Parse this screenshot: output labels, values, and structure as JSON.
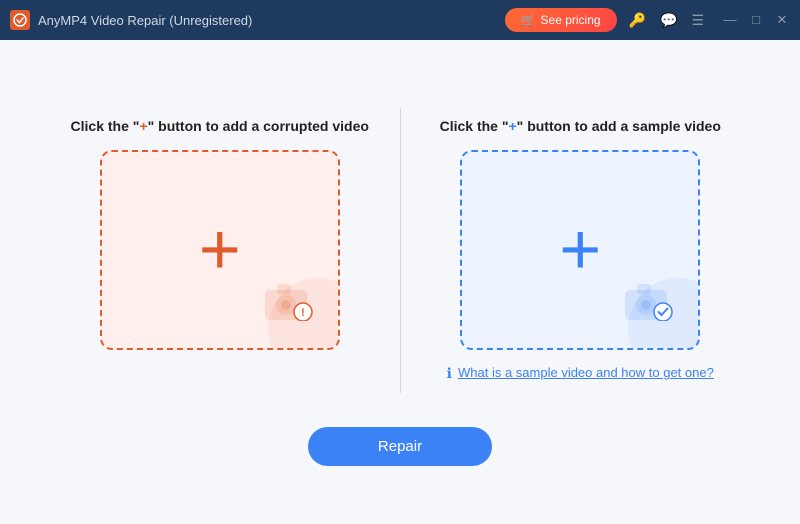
{
  "titleBar": {
    "appName": "AnyMP4 Video Repair (Unregistered)",
    "seePricingLabel": "See pricing",
    "icons": {
      "key": "🔑",
      "chat": "💬",
      "menu": "☰",
      "minimize": "—",
      "maximize": "□",
      "close": "✕"
    }
  },
  "leftPanel": {
    "titlePrefix": "Click the \"",
    "plusSymbol": "+",
    "titleSuffix": "\" button to add a corrupted video",
    "dropZoneAriaLabel": "Add corrupted video"
  },
  "rightPanel": {
    "titlePrefix": "Click the \"",
    "plusSymbol": "+",
    "titleSuffix": "\" button to add a sample video",
    "dropZoneAriaLabel": "Add sample video",
    "sampleLinkText": "What is a sample video and how to get one?"
  },
  "footer": {
    "repairLabel": "Repair"
  }
}
